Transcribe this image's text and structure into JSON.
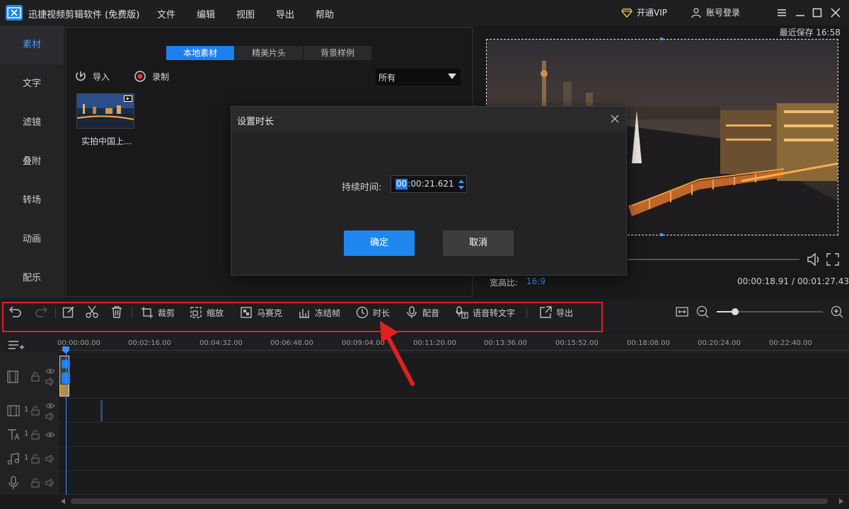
{
  "app": {
    "title": "迅捷视频剪辑软件 (免费版)",
    "menu": [
      "文件",
      "编辑",
      "视图",
      "导出",
      "帮助"
    ],
    "vip_label": "开通VIP",
    "account_label": "账号登录"
  },
  "sidebar": {
    "items": [
      "素材",
      "文字",
      "滤镜",
      "叠附",
      "转场",
      "动画",
      "配乐"
    ],
    "active": "素材"
  },
  "media": {
    "tabs": [
      "本地素材",
      "精美片头",
      "背景样例"
    ],
    "import_label": "导入",
    "record_label": "录制",
    "filter_value": "所有",
    "items": [
      {
        "name": "实拍中国上..."
      }
    ]
  },
  "preview": {
    "last_saved": "最近保存 16:58",
    "aspect_label": "宽高比:",
    "aspect_value": "16:9",
    "current_time": "00:00:18.91",
    "total_time": "00:01:27.43",
    "time_separator": "/"
  },
  "dialog": {
    "title": "设置时长",
    "duration_label": "持续时间:",
    "duration_hh": "00",
    "duration_rest": ":00:21.621",
    "confirm_label": "确定",
    "cancel_label": "取消"
  },
  "toolbar": {
    "crop": "裁剪",
    "zoom": "缩放",
    "mosaic": "马赛克",
    "freeze": "冻结帧",
    "duration": "时长",
    "voiceover": "配音",
    "speech_to_text": "语音转文字",
    "export": "导出"
  },
  "timeline": {
    "ticks": [
      "00:00:00.00",
      "00:02:16.00",
      "00:04:32.00",
      "00:06:48.00",
      "00:09:04.00",
      "00:11:20.00",
      "00:13:36.00",
      "00:15:52.00",
      "00:18:08.00",
      "00:20:24.00",
      "00:22:40.00"
    ],
    "track_numbers": [
      "1",
      "1",
      "1"
    ]
  },
  "colors": {
    "accent": "#1e7ff0",
    "highlight_box": "#e02020"
  }
}
